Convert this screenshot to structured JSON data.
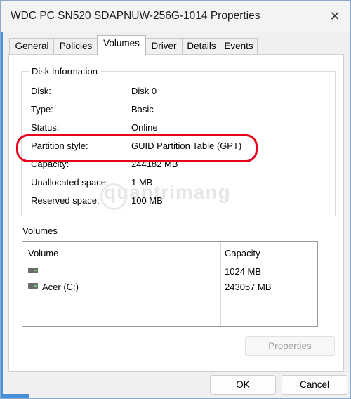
{
  "window": {
    "title": "WDC PC SN520 SDAPNUW-256G-1014 Properties",
    "close_glyph": "✕"
  },
  "tabs": [
    {
      "label": "General"
    },
    {
      "label": "Policies"
    },
    {
      "label": "Volumes"
    },
    {
      "label": "Driver"
    },
    {
      "label": "Details"
    },
    {
      "label": "Events"
    }
  ],
  "active_tab": "Volumes",
  "disk_info": {
    "title": "Disk Information",
    "rows": [
      {
        "label": "Disk:",
        "value": "Disk 0"
      },
      {
        "label": "Type:",
        "value": "Basic"
      },
      {
        "label": "Status:",
        "value": "Online"
      },
      {
        "label": "Partition style:",
        "value": "GUID Partition Table (GPT)"
      },
      {
        "label": "Capacity:",
        "value": "244182 MB"
      },
      {
        "label": "Unallocated space:",
        "value": "1 MB"
      },
      {
        "label": "Reserved space:",
        "value": "100 MB"
      }
    ]
  },
  "watermark": "quantrimang",
  "volumes": {
    "title": "Volumes",
    "headers": {
      "volume": "Volume",
      "capacity": "Capacity"
    },
    "rows": [
      {
        "name": "",
        "capacity": "1024 MB"
      },
      {
        "name": "Acer (C:)",
        "capacity": "243057 MB"
      }
    ]
  },
  "buttons": {
    "properties": "Properties",
    "ok": "OK",
    "cancel": "Cancel"
  },
  "colors": {
    "highlight": "#e8001c",
    "accent": "#4a90d9"
  }
}
